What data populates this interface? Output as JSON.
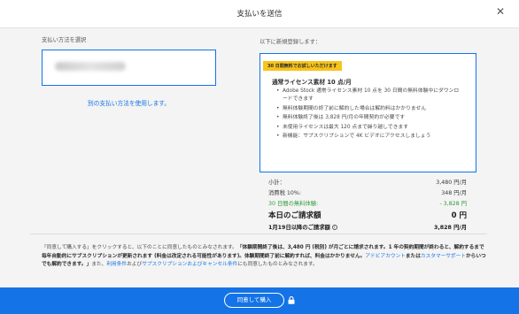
{
  "header": {
    "title": "支払いを送信",
    "close_icon": "close-icon"
  },
  "payment": {
    "section_label": "支払い方法を選択",
    "alt_link": "別の支払い方法を使用します。"
  },
  "plan": {
    "section_label": "以下に新規登録します：",
    "badge": "30 日間無料でお試しいただけます",
    "name": "通常ライセンス素材 10 点/月",
    "features": [
      "Adobe Stock 通常ライセンス素材 10 点を 30 日間の無料体験中にダウンロードできます",
      "無料体験期間の終了前に解約した場合は解約料はかかりません",
      "無料体験終了後は 3,828 円/月の年間契約が必要です",
      "未使用ライセンスは最大 120 点まで繰り越しできます",
      "新機能：サブスクリプションで 4K ビデオにアクセスしましょう"
    ]
  },
  "summary": {
    "subtotal_label": "小計：",
    "subtotal_value": "3,480 円/月",
    "tax_label": "消費税 10%:",
    "tax_value": "348 円/月",
    "trial_label": "30 日間の無料体験:",
    "trial_value": "- 3,828 円",
    "today_label": "本日のご請求額",
    "today_value": "0 円",
    "future_label": "1月19日以降のご請求額",
    "future_value": "3,828 円/月",
    "accent_green": "#2d9d3a"
  },
  "terms": {
    "p1": "「同意して購入する」をクリックすると、以下のことに同意したものとみなされます。",
    "p1b": "「体験期間終了後は、3,480 円 (税別) が月ごとに請求されます。1 年の契約期間が終わると、解約するまで毎年自動的にサブスクリプションが更新されます (料金は改定される可能性があります)。体験期間終了前に解約すれば、料金はかかりません。",
    "link_account": "アドビアカウント",
    "t_or": "または",
    "link_support": "カスタマーサポート",
    "t_cancel": "からいつでも解約できます。」",
    "t_also": "また、",
    "link_terms": "利用条件",
    "t_and": "および",
    "link_sub": "サブスクリプションおよびキャンセル条件",
    "t_end": "にも同意したものとみなされます。"
  },
  "footer": {
    "button_label": "同意して購入",
    "lock_icon": "lock-icon",
    "brand_color": "#1473e6"
  }
}
